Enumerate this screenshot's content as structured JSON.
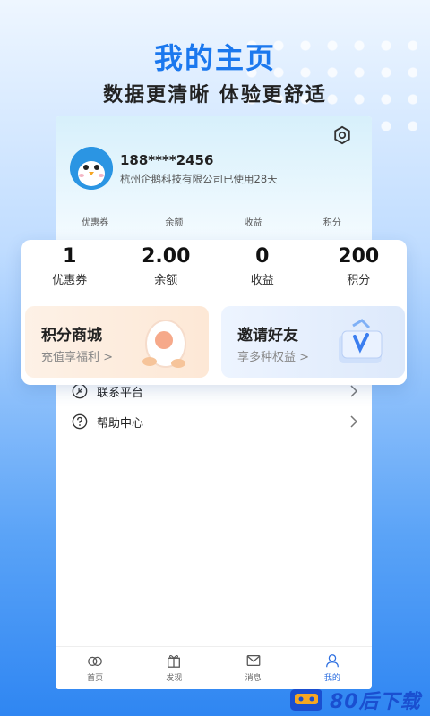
{
  "hero": {
    "title": "我的主页",
    "subtitle": "数据更清晰 体验更舒适"
  },
  "profile": {
    "phone": "188****2456",
    "company": "杭州企鹅科技有限公司已使用28天"
  },
  "mini_stats": [
    "优惠券",
    "余额",
    "收益",
    "积分"
  ],
  "stats": [
    {
      "value": "1",
      "label": "优惠券"
    },
    {
      "value": "2.00",
      "label": "余额"
    },
    {
      "value": "0",
      "label": "收益"
    },
    {
      "value": "200",
      "label": "积分"
    }
  ],
  "promos": {
    "left": {
      "title": "积分商城",
      "subtitle": "充值享福利 >"
    },
    "right": {
      "title": "邀请好友",
      "subtitle": "享多种权益 >"
    }
  },
  "menu": [
    {
      "label": "联系平台",
      "icon": "leaf-icon"
    },
    {
      "label": "帮助中心",
      "icon": "help-icon"
    }
  ],
  "tabs": [
    {
      "label": "首页",
      "icon": "home-icon"
    },
    {
      "label": "发现",
      "icon": "gift-icon"
    },
    {
      "label": "消息",
      "icon": "message-icon"
    },
    {
      "label": "我的",
      "icon": "profile-icon",
      "active": true
    }
  ],
  "watermark": {
    "text": "80后下载"
  },
  "colors": {
    "accent": "#1b78ee",
    "tab_active": "#2d6fe0"
  }
}
